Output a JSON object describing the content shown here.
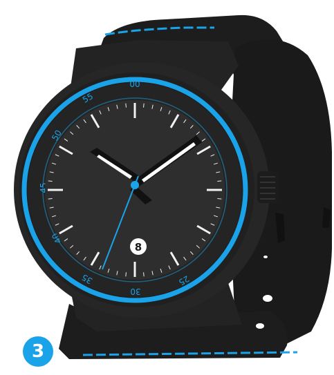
{
  "colors": {
    "accent": "#1aa3e8",
    "strap": "#1d1d1d",
    "case": "#262626",
    "dial": "#2e2e2e",
    "bezel": "#242424",
    "marker": "#f2f2f2"
  },
  "bezel_numbers": [
    "30",
    "25",
    "35",
    "40",
    "45",
    "50",
    "55",
    "00"
  ],
  "date_window": "8",
  "step_badge": "3",
  "icons": {
    "crown": "watch-crown",
    "step": "step-number-badge"
  }
}
